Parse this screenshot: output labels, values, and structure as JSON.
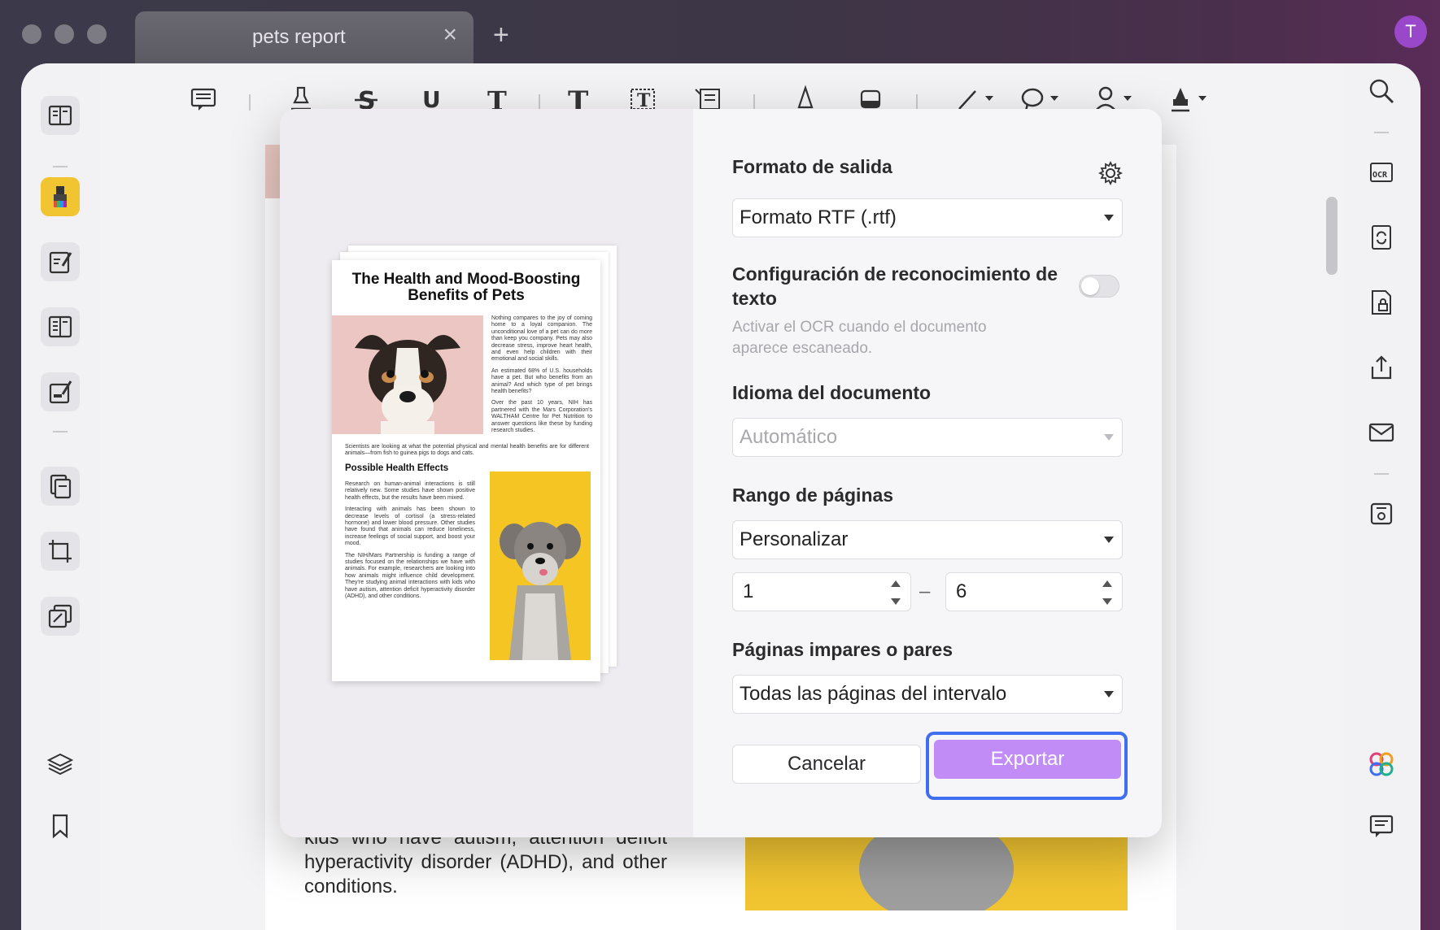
{
  "window": {
    "tab_title": "pets report",
    "tab_close": "×",
    "tab_add": "+",
    "avatar_initial": "T"
  },
  "document": {
    "visible_text": "kids who have autism, attention deficit hyperactivity disorder (ADHD), and other conditions."
  },
  "dialog": {
    "preview": {
      "title": "The Health and Mood-Boosting Benefits of Pets",
      "intro_col": [
        "Nothing compares to the joy of coming home to a loyal companion. The unconditional love of a pet can do more than keep you company. Pets may also decrease stress, improve heart health, and even help children with their emotional and social skills.",
        "An estimated 68% of U.S. households have a pet. But who benefits from an animal? And which type of pet brings health benefits?",
        "Over the past 10 years, NIH has partnered with the Mars Corporation's WALTHAM Centre for Pet Nutrition to answer questions like these by funding research studies."
      ],
      "wide_par": "Scientists are looking at what the potential physical and mental health benefits are for different animals—from fish to guinea pigs to dogs and cats.",
      "section_heading": "Possible Health Effects",
      "section_col": [
        "Research on human-animal interactions is still relatively new. Some studies have shown positive health effects, but the results have been mixed.",
        "Interacting with animals has been shown to decrease levels of cortisol (a stress-related hormone) and lower blood pressure. Other studies have found that animals can reduce loneliness, increase feelings of social support, and boost your mood.",
        "The NIH/Mars Partnership is funding a range of studies focused on the relationships we have with animals. For example, researchers are looking into how animals might influence child development. They're studying animal interactions with kids who have autism, attention deficit hyperactivity disorder (ADHD), and other conditions."
      ]
    },
    "output_format": {
      "label": "Formato de salida",
      "value": "Formato RTF (.rtf)"
    },
    "ocr": {
      "label": "Configuración de reconocimiento de texto",
      "hint": "Activar el OCR cuando el documento aparece escaneado.",
      "enabled": false
    },
    "language": {
      "label": "Idioma del documento",
      "value": "Automático"
    },
    "page_range": {
      "label": "Rango de páginas",
      "value": "Personalizar",
      "from": "1",
      "to": "6",
      "separator": "–"
    },
    "odd_even": {
      "label": "Páginas impares o pares",
      "value": "Todas las páginas del intervalo"
    },
    "cancel_label": "Cancelar",
    "export_label": "Exportar"
  },
  "colors": {
    "accent_export": "#c28cf7",
    "focus_ring": "#3f6ef0",
    "highlighter_active": "#f1c531"
  }
}
